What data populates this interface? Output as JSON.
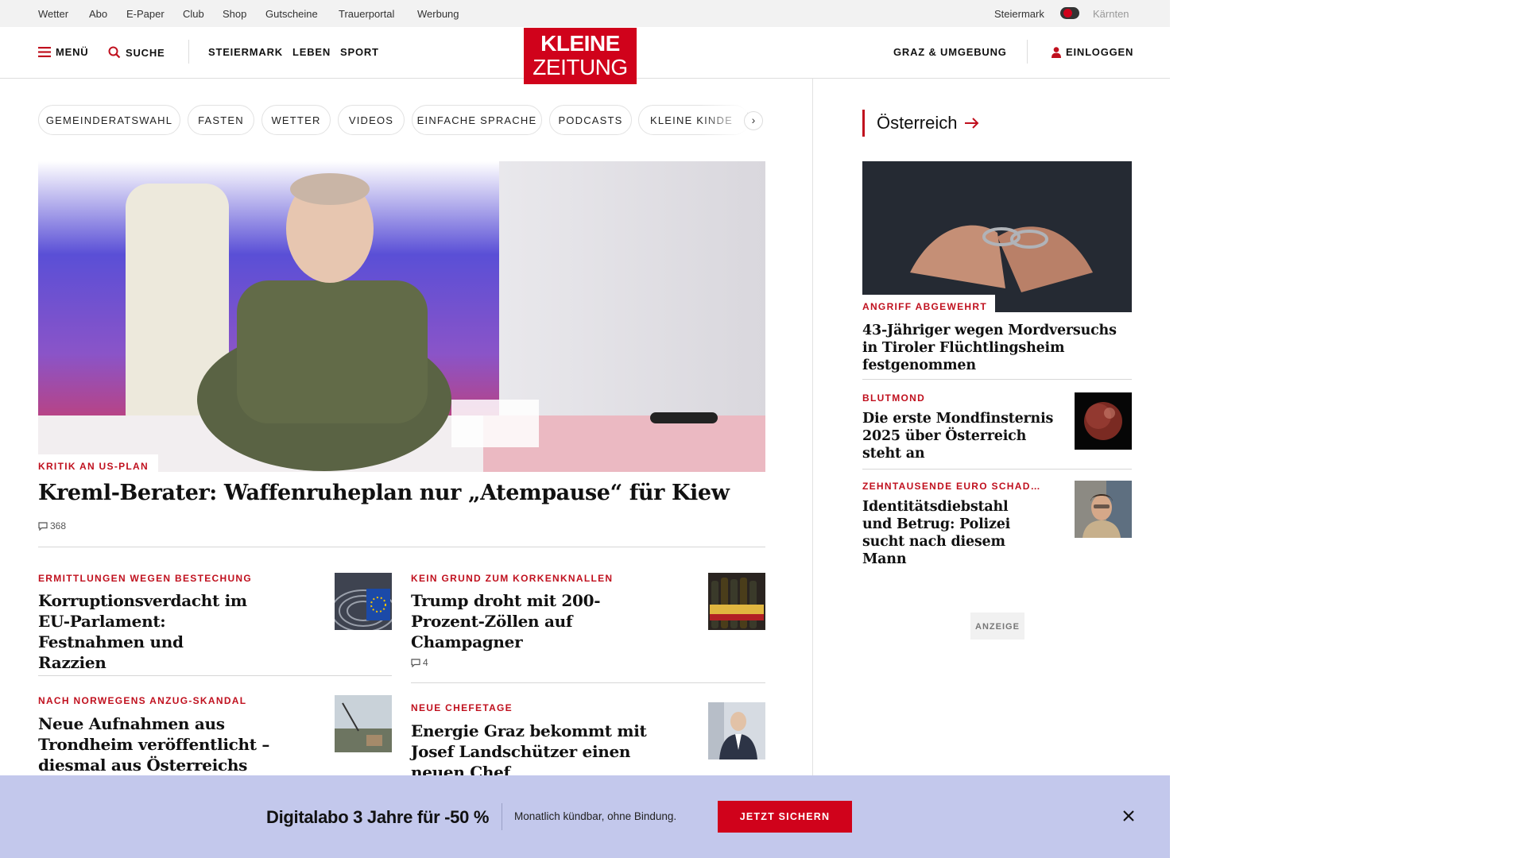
{
  "utility_nav": {
    "links": [
      "Wetter",
      "Abo",
      "E-Paper",
      "Club",
      "Shop",
      "Gutscheine",
      "Trauerportal",
      "Werbung"
    ],
    "region_selected": "Steiermark",
    "region_other": "Kärnten"
  },
  "header": {
    "menu_label": "MENÜ",
    "search_label": "SUCHE",
    "nav": [
      "STEIERMARK",
      "LEBEN",
      "SPORT"
    ],
    "logo_line1": "KLEINE",
    "logo_line2": "ZEITUNG",
    "local_label": "GRAZ & UMGEBUNG",
    "login_label": "EINLOGGEN",
    "brand_color": "#d0021b"
  },
  "topic_chips": [
    "GEMEINDERATSWAHL",
    "FASTEN",
    "WETTER",
    "VIDEOS",
    "EINFACHE SPRACHE",
    "PODCASTS",
    "KLEINE KINDE"
  ],
  "hero": {
    "kicker": "KRITIK AN US-PLAN",
    "title": "Kreml-Berater: Waffenruheplan nur „Atempause“ für Kiew",
    "comments": "368"
  },
  "stories": [
    {
      "kicker": "ERMITTLUNGEN WEGEN BESTECHUNG",
      "title": "Korruptionsverdacht im EU-Parlament: Festnahmen und Razzien",
      "thumb": "eu-parliament-image"
    },
    {
      "kicker": "KEIN GRUND ZUM KORKENKNALLEN",
      "title": "Trump droht mit 200-Prozent-Zöllen auf Champagner",
      "comments": "4",
      "thumb": "champagne-image"
    },
    {
      "kicker": "NACH NORWEGENS ANZUG-SKANDAL",
      "title": "Neue Aufnahmen aus Trondheim veröffentlicht – diesmal aus Österreichs Aufwärmraum",
      "thumb": "ski-jump-image"
    },
    {
      "kicker": "NEUE CHEFETAGE",
      "title": "Energie Graz bekommt mit Josef Landschützer einen neuen Chef",
      "thumb": "portrait-image"
    }
  ],
  "sidebar": {
    "section_title": "Österreich",
    "lead": {
      "kicker": "ANGRIFF ABGEWEHRT",
      "title": "43-Jähriger wegen Mordversuchs in Tiroler Flüchtlingsheim festgenommen"
    },
    "items": [
      {
        "kicker": "BLUTMOND",
        "title": "Die erste Mondfinsternis 2025 über Österreich steht an",
        "thumb": "blood-moon-image"
      },
      {
        "kicker": "ZEHNTAUSENDE EURO SCHAD…",
        "title": "Identitätsdiebstahl und Betrug: Polizei sucht nach diesem Mann",
        "thumb": "suspect-image"
      }
    ],
    "ad_label": "ANZEIGE"
  },
  "promo": {
    "headline": "Digitalabo 3 Jahre für -50 %",
    "subline": "Monatlich kündbar, ohne Bindung.",
    "button": "JETZT SICHERN",
    "background": "#c3c8ec"
  }
}
